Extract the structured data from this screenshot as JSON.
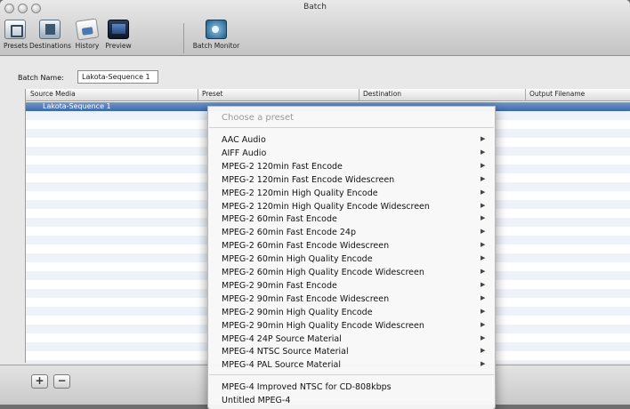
{
  "window": {
    "title": "Batch"
  },
  "toolbar": {
    "presets": "Presets",
    "destinations": "Destinations",
    "history": "History",
    "preview": "Preview",
    "batch_monitor": "Batch Monitor"
  },
  "batch": {
    "name_label": "Batch Name:",
    "name_value": "Lakota-Sequence 1"
  },
  "table": {
    "headers": {
      "source": "Source Media",
      "preset": "Preset",
      "destination": "Destination",
      "output": "Output Filename"
    },
    "rows": [
      {
        "source": "Lakota-Sequence 1",
        "preset": "",
        "destination": "",
        "output": ""
      }
    ]
  },
  "preset_menu": {
    "header": "Choose a preset",
    "submenu_items": [
      "AAC Audio",
      "AIFF Audio",
      "MPEG-2 120min Fast Encode",
      "MPEG-2 120min Fast Encode Widescreen",
      "MPEG-2 120min High Quality Encode",
      "MPEG-2 120min High Quality Encode Widescreen",
      "MPEG-2 60min Fast Encode",
      "MPEG-2 60min Fast Encode 24p",
      "MPEG-2 60min Fast Encode Widescreen",
      "MPEG-2 60min High Quality Encode",
      "MPEG-2 60min High Quality Encode Widescreen",
      "MPEG-2 90min Fast Encode",
      "MPEG-2 90min Fast Encode Widescreen",
      "MPEG-2 90min High Quality Encode",
      "MPEG-2 90min High Quality Encode Widescreen",
      "MPEG-4 24P Source Material",
      "MPEG-4 NTSC Source Material",
      "MPEG-4 PAL Source Material"
    ],
    "custom_items": [
      "MPEG-4 Improved NTSC for CD-808kbps",
      "Untitled MPEG-4"
    ]
  },
  "bottom": {
    "add": "+",
    "remove": "−"
  },
  "icons": {
    "presets": "presets-icon",
    "destinations": "destinations-icon",
    "history": "history-icon",
    "preview": "preview-icon",
    "batch_monitor": "batch-monitor-icon",
    "submenu_arrow": "▶"
  }
}
